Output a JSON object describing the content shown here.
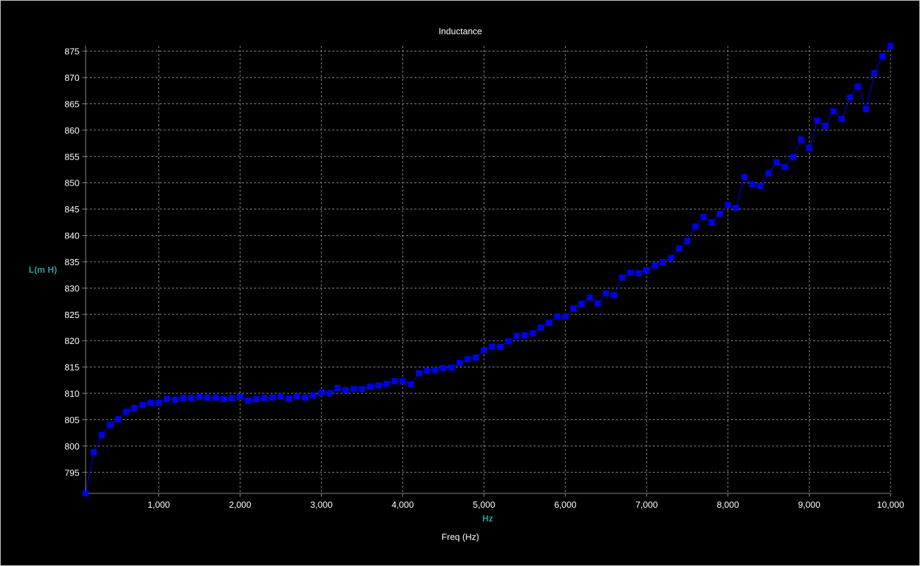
{
  "chart_data": {
    "type": "line",
    "title": "Inductance",
    "xlabel": "Freq (Hz)",
    "x_unit_label": "Hz",
    "ylabel": "L(m H)",
    "xlim": [
      100,
      10000
    ],
    "ylim": [
      791,
      876
    ],
    "x_ticks": [
      1000,
      2000,
      3000,
      4000,
      5000,
      6000,
      7000,
      8000,
      9000,
      10000
    ],
    "x_tick_labels": [
      "1,000",
      "2,000",
      "3,000",
      "4,000",
      "5,000",
      "6,000",
      "7,000",
      "8,000",
      "9,000",
      "10,000"
    ],
    "y_ticks": [
      795,
      800,
      805,
      810,
      815,
      820,
      825,
      830,
      835,
      840,
      845,
      850,
      855,
      860,
      865,
      870,
      875
    ],
    "y_tick_labels": [
      "795",
      "800",
      "805",
      "810",
      "815",
      "820",
      "825",
      "830",
      "835",
      "840",
      "845",
      "850",
      "855",
      "860",
      "865",
      "870",
      "875"
    ],
    "grid": true,
    "colors": {
      "background": "#000000",
      "series": "#0000ff",
      "marker": "#0000e6",
      "grid": "#8c8c8c",
      "axis": "#8c8c8c",
      "text": "#ffffff",
      "unit_text": "#2a9a9a"
    },
    "series": [
      {
        "marker": "square",
        "x": [
          100,
          200,
          300,
          400,
          500,
          600,
          700,
          800,
          900,
          1000,
          1100,
          1200,
          1300,
          1400,
          1500,
          1600,
          1700,
          1800,
          1900,
          2000,
          2100,
          2200,
          2300,
          2400,
          2500,
          2600,
          2700,
          2800,
          2900,
          3000,
          3100,
          3200,
          3300,
          3400,
          3500,
          3600,
          3700,
          3800,
          3900,
          4000,
          4100,
          4200,
          4300,
          4400,
          4500,
          4600,
          4700,
          4800,
          4900,
          5000,
          5100,
          5200,
          5300,
          5400,
          5500,
          5600,
          5700,
          5800,
          5900,
          6000,
          6100,
          6200,
          6300,
          6400,
          6500,
          6600,
          6700,
          6800,
          6900,
          7000,
          7100,
          7200,
          7300,
          7400,
          7500,
          7600,
          7700,
          7800,
          7900,
          8000,
          8100,
          8200,
          8300,
          8400,
          8500,
          8600,
          8700,
          8800,
          8900,
          9000,
          9100,
          9200,
          9300,
          9400,
          9500,
          9600,
          9700,
          9800,
          9900,
          10000
        ],
        "values": [
          791.0,
          798.8,
          802.1,
          804.0,
          805.1,
          806.5,
          807.2,
          807.8,
          808.2,
          808.2,
          808.9,
          808.8,
          809.1,
          809.1,
          809.3,
          809.2,
          809.2,
          808.9,
          809.1,
          809.3,
          808.6,
          808.9,
          809.1,
          809.2,
          809.4,
          809.0,
          809.4,
          809.2,
          809.6,
          810.1,
          810.0,
          811.0,
          810.6,
          810.8,
          810.8,
          811.3,
          811.5,
          811.8,
          812.3,
          812.3,
          811.7,
          813.8,
          814.3,
          814.4,
          814.8,
          814.9,
          815.8,
          816.5,
          816.8,
          818.2,
          818.9,
          818.8,
          819.9,
          820.9,
          821.0,
          821.4,
          822.5,
          823.4,
          824.6,
          824.6,
          826.1,
          827.0,
          828.2,
          827.1,
          829.0,
          828.6,
          832.0,
          832.9,
          832.8,
          833.4,
          834.3,
          834.9,
          835.7,
          837.5,
          838.9,
          841.7,
          843.5,
          842.5,
          844.1,
          845.8,
          845.2,
          851.1,
          849.7,
          849.4,
          851.8,
          853.9,
          853.0,
          854.9,
          858.2,
          856.6,
          861.8,
          860.8,
          863.6,
          862.1,
          866.2,
          868.3,
          864.0,
          870.8,
          874.0,
          876.0
        ]
      }
    ]
  }
}
